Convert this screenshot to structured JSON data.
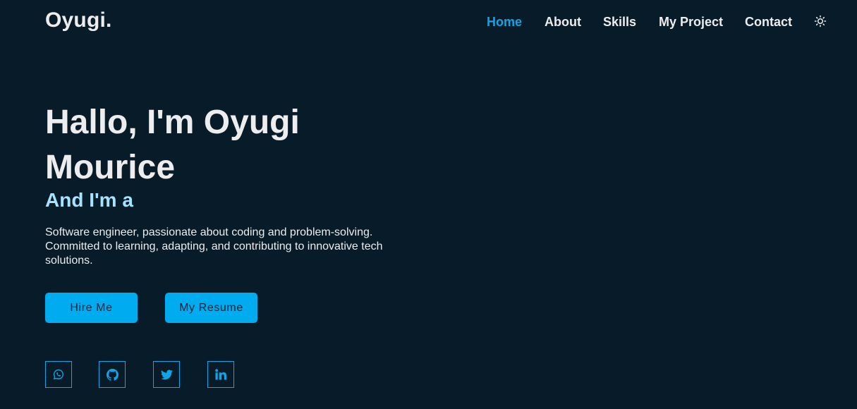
{
  "header": {
    "logo": "Oyugi.",
    "nav": [
      {
        "label": "Home",
        "active": true
      },
      {
        "label": "About",
        "active": false
      },
      {
        "label": "Skills",
        "active": false
      },
      {
        "label": "My Project",
        "active": false
      },
      {
        "label": "Contact",
        "active": false
      }
    ],
    "theme_toggle_icon": "sun-icon"
  },
  "hero": {
    "title": "Hallo, I'm Oyugi Mourice",
    "subtitle": "And I'm a",
    "description": "Software engineer, passionate about coding and problem-solving. Committed to learning, adapting, and contributing to innovative tech solutions.",
    "buttons": {
      "hire": "Hire Me",
      "resume": "My Resume"
    },
    "socials": [
      "whatsapp-icon",
      "github-icon",
      "twitter-icon",
      "linkedin-icon"
    ]
  },
  "colors": {
    "background": "#081b29",
    "accent": "#0ea5e9",
    "button": "#00abf0",
    "subtitle": "#a5e4ff",
    "text": "#ededed"
  }
}
